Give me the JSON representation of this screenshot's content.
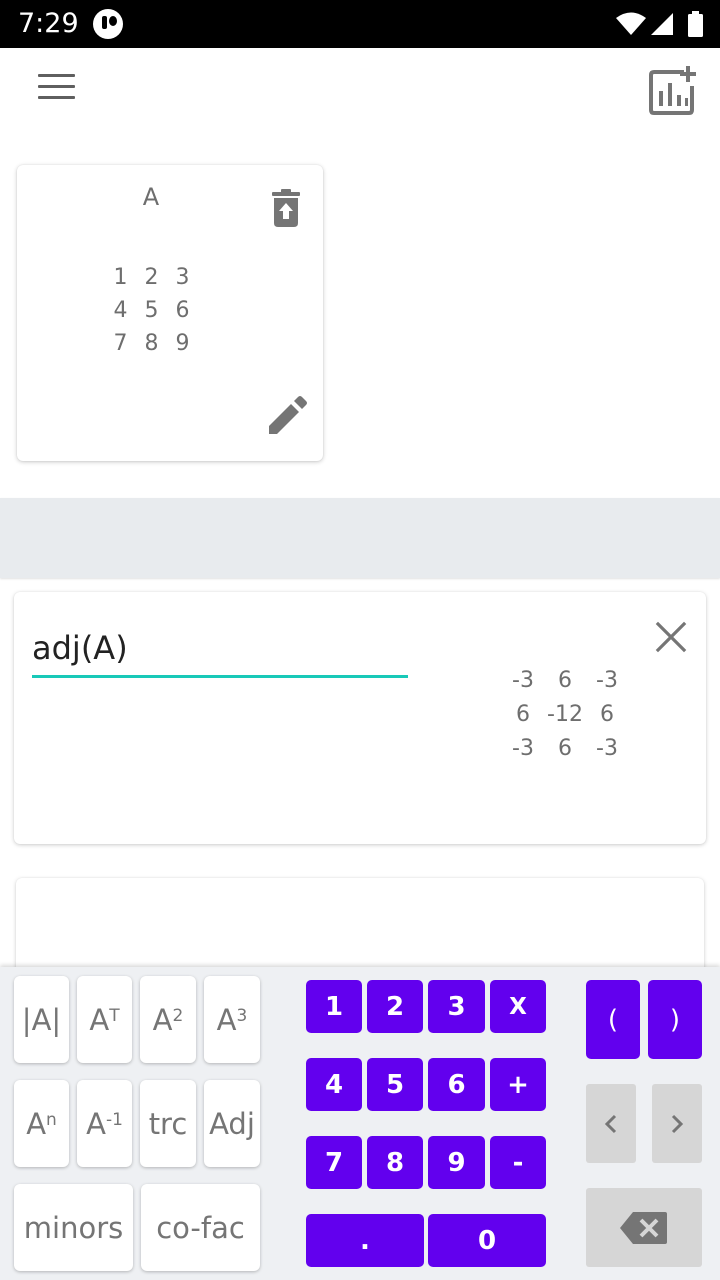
{
  "status_bar": {
    "time": "7:29"
  },
  "matrix_card": {
    "name": "A",
    "rows": [
      [
        "1",
        "2",
        "3"
      ],
      [
        "4",
        "5",
        "6"
      ],
      [
        "7",
        "8",
        "9"
      ]
    ]
  },
  "expression": {
    "input_value": "adj(A)",
    "result_rows": [
      [
        "-3",
        "6",
        "-3"
      ],
      [
        "6",
        "-12",
        "6"
      ],
      [
        "-3",
        "6",
        "-3"
      ]
    ]
  },
  "keyboard": {
    "function_keys": {
      "det": "|A|",
      "transpose_base": "A",
      "transpose_sup": "T",
      "square_base": "A",
      "square_sup": "2",
      "cube_base": "A",
      "cube_sup": "3",
      "power_base": "A",
      "power_sup": "n",
      "inverse_base": "A",
      "inverse_sup": "-1",
      "trace": "trc",
      "adjoint": "Adj",
      "minors": "minors",
      "cofactor": "co-fac"
    },
    "number_keys": {
      "k1": "1",
      "k2": "2",
      "k3": "3",
      "multiply": "X",
      "k4": "4",
      "k5": "5",
      "k6": "6",
      "plus": "+",
      "k7": "7",
      "k8": "8",
      "k9": "9",
      "minus": "-",
      "dot": ".",
      "k0": "0"
    },
    "paren_keys": {
      "open": "(",
      "close": ")"
    }
  },
  "colors": {
    "accent": "#6200ee",
    "underline": "#18c9b8",
    "icon_grey": "#757575"
  }
}
